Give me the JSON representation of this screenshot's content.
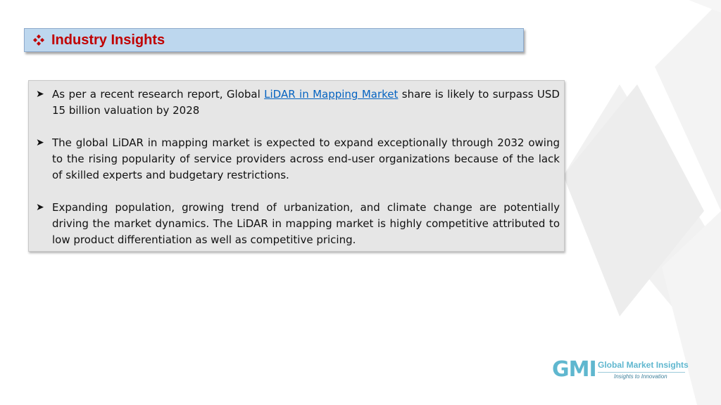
{
  "header": {
    "title": "Industry Insights",
    "icon": "diamond-bullet-icon",
    "title_color": "#c00000",
    "bar_color": "#bdd7ee"
  },
  "content": {
    "bullets": [
      {
        "prefix": "As per a recent research report, Global ",
        "link": "LiDAR in Mapping Market",
        "suffix": " share is likely to surpass USD 15 billion valuation by 2028"
      },
      {
        "text": "The global LiDAR in mapping market is expected to expand exceptionally through 2032 owing to the rising popularity of service providers across end-user organizations because of the lack of skilled experts and budgetary restrictions."
      },
      {
        "text": "Expanding population, growing trend of urbanization, and climate change are potentially driving the market dynamics. The LiDAR in mapping market is highly competitive attributed to low product differentiation as well as competitive pricing."
      }
    ],
    "bullet_icon": "arrow-bullet-icon",
    "link_color": "#0563c1"
  },
  "logo": {
    "mark": "GMI",
    "name": "Global Market Insights",
    "tagline": "Insights to Innovation",
    "color": "#5fb7cf"
  }
}
